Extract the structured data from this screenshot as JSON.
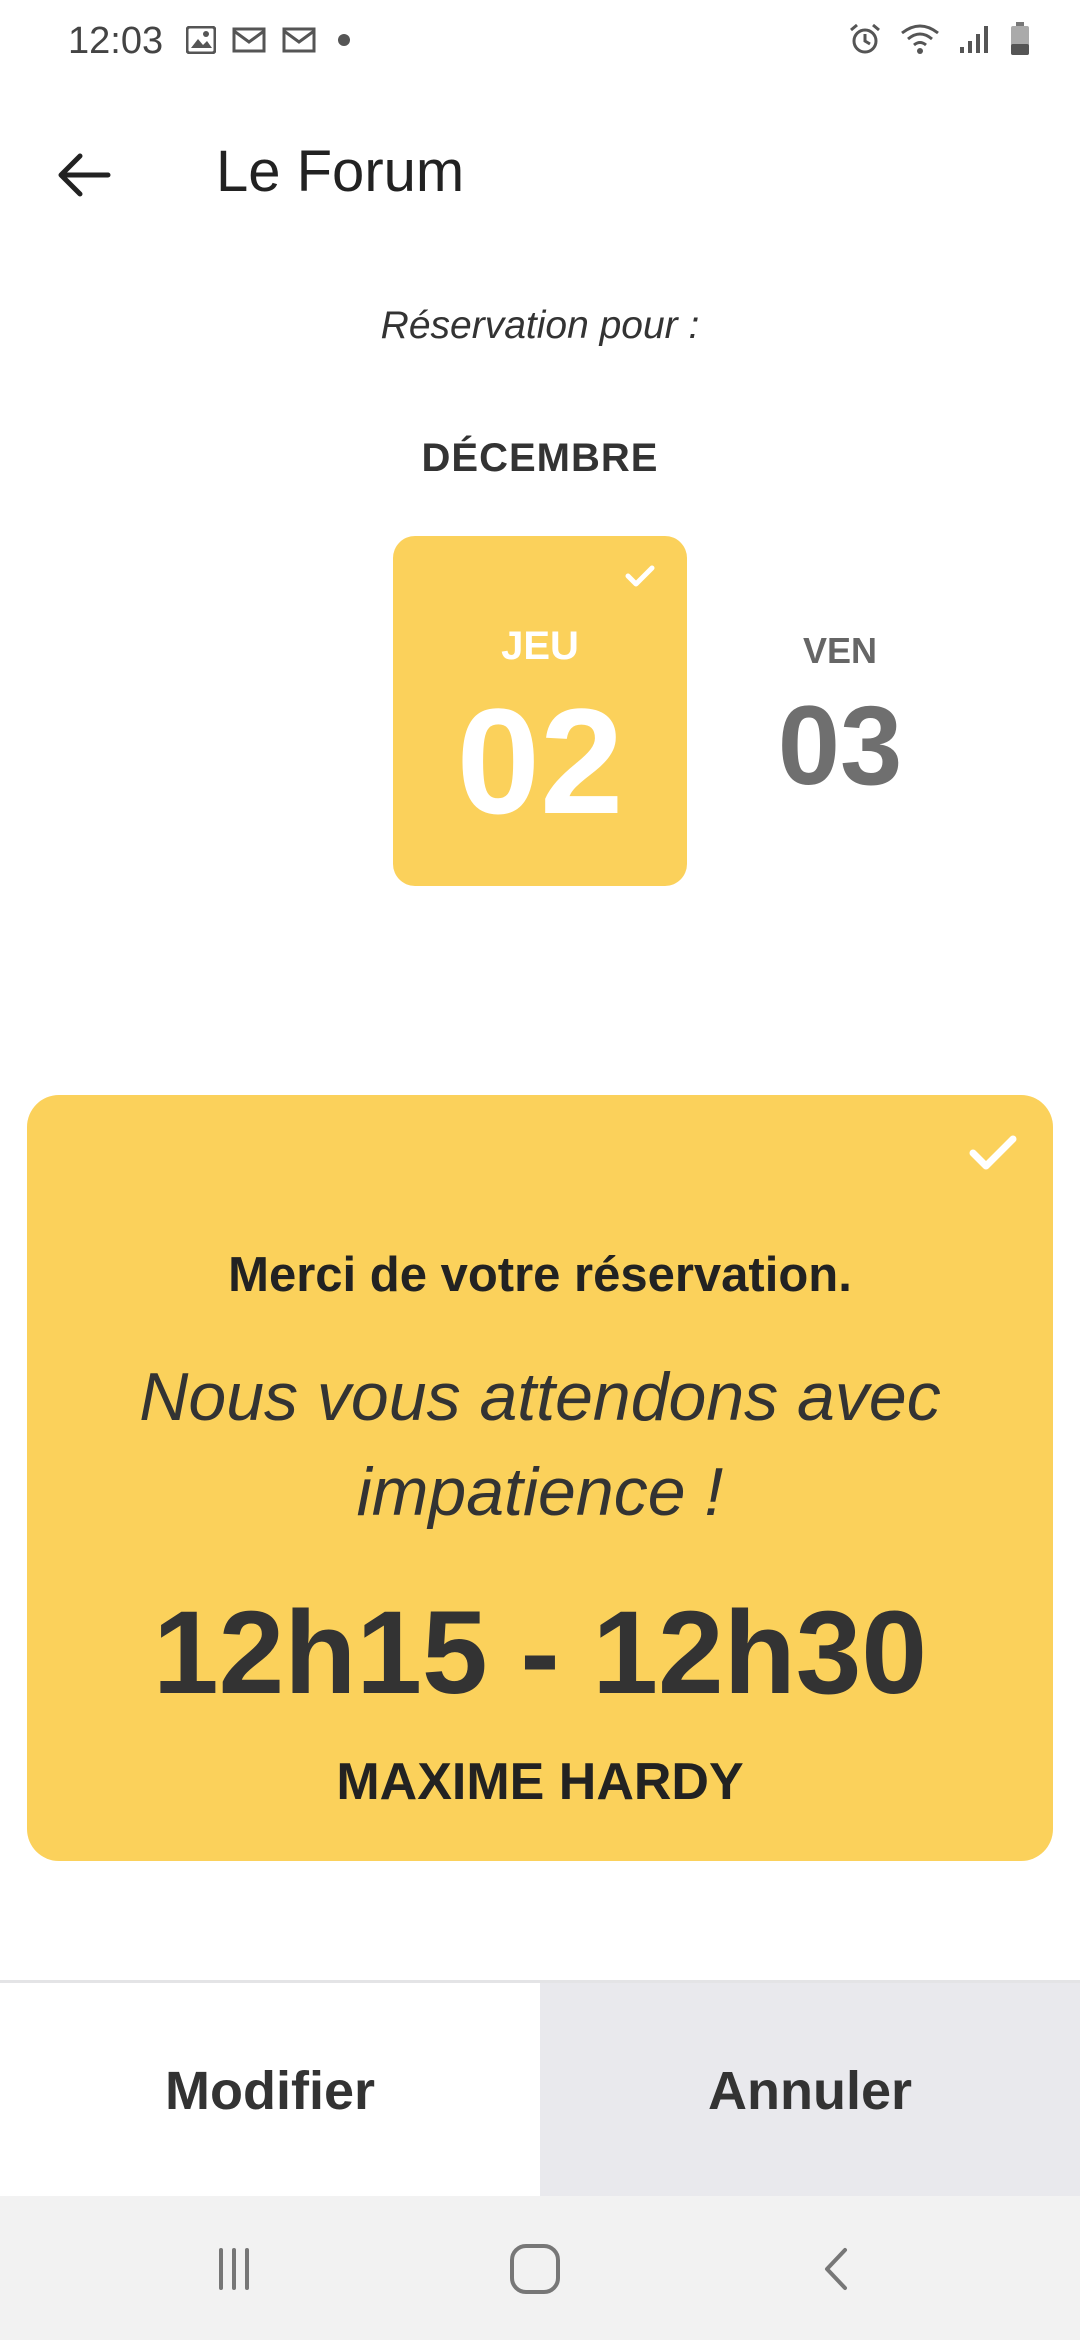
{
  "status_bar": {
    "time": "12:03",
    "left_icons": [
      "image-icon",
      "mail-icon",
      "mail-icon",
      "dot-icon"
    ],
    "right_icons": [
      "alarm-icon",
      "wifi-icon",
      "signal-icon",
      "battery-icon"
    ]
  },
  "app_bar": {
    "title": "Le Forum",
    "back_icon": "arrow-left-icon"
  },
  "reservation": {
    "label": "Réservation pour :",
    "month": "DÉCEMBRE",
    "days": [
      {
        "dow": "JEU",
        "num": "02",
        "selected": true
      },
      {
        "dow": "VEN",
        "num": "03",
        "selected": false
      }
    ]
  },
  "confirmation": {
    "thanks": "Merci de votre réservation.",
    "wait": "Nous vous attendons avec impatience !",
    "time_range": "12h15 - 12h30",
    "name": "MAXIME HARDY"
  },
  "actions": {
    "modify": "Modifier",
    "cancel": "Annuler"
  },
  "colors": {
    "accent": "#fbd15b",
    "cancel_bg": "#e9e9ed",
    "text": "#333333"
  },
  "nav_bar": {
    "icons": [
      "recent-apps-icon",
      "home-icon",
      "back-icon"
    ]
  }
}
